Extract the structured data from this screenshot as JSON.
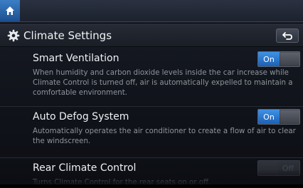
{
  "header": {
    "home_icon": "home-icon"
  },
  "titlebar": {
    "title": "Climate Settings",
    "settings_icon": "gear-icon",
    "back_icon": "back-arrow-icon"
  },
  "settings": [
    {
      "title": "Smart Ventilation",
      "description": "When humidity and carbon dioxide levels inside the car increase while Climate Control is turned off, air is automatically expelled to maintain a comfortable environment.",
      "toggle_label": "On",
      "state": "on"
    },
    {
      "title": "Auto Defog System",
      "description": "Automatically operates the air conditioner to create a flow of air to clear the windscreen.",
      "toggle_label": "On",
      "state": "on"
    },
    {
      "title": "Rear Climate Control",
      "description": "Turns Climate Control for the rear seats on or off.",
      "toggle_label": "Off",
      "state": "off"
    }
  ],
  "colors": {
    "accent_blue": "#2f7fd6",
    "background": "#12151c",
    "text_secondary": "#8f949c"
  }
}
